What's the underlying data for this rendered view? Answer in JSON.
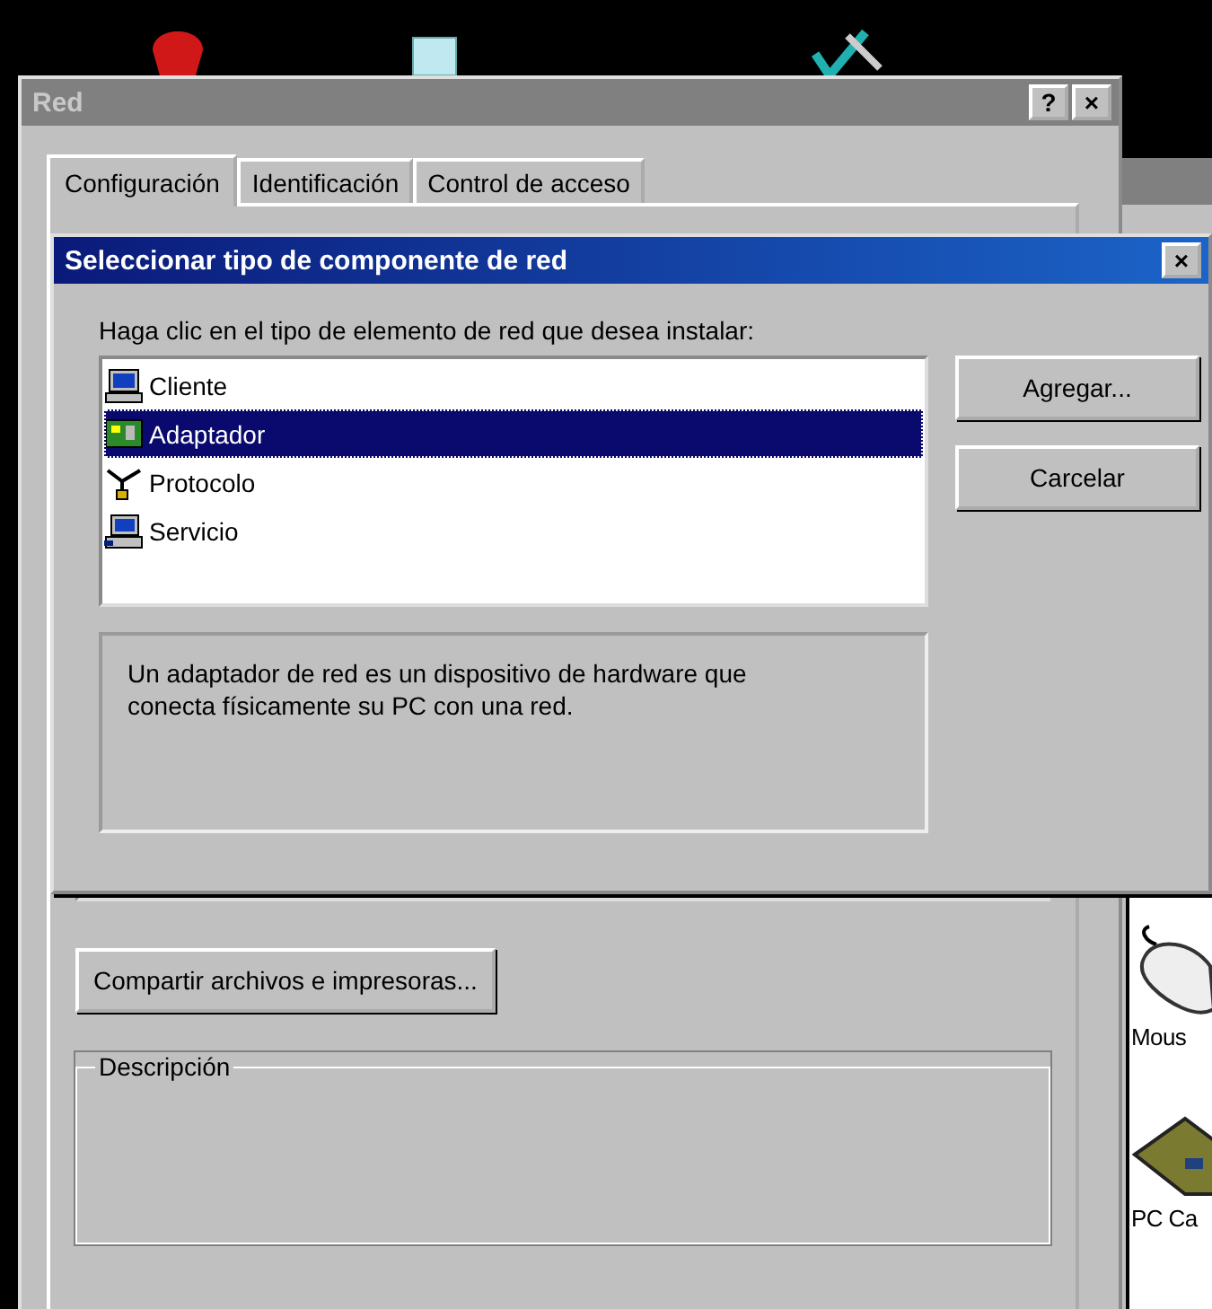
{
  "main_window": {
    "title": "Red",
    "help_button": "?",
    "close_button": "×",
    "tabs": [
      {
        "label": "Configuración",
        "selected": true
      },
      {
        "label": "Identificación",
        "selected": false
      },
      {
        "label": "Control de acceso",
        "selected": false
      }
    ],
    "share_button": "Compartir archivos e impresoras...",
    "description_legend": "Descripción"
  },
  "dialog": {
    "title": "Seleccionar tipo de componente de red",
    "close_button": "×",
    "instruction": "Haga clic en el tipo de elemento de red que desea instalar:",
    "components": [
      {
        "label": "Cliente",
        "kind": "client",
        "selected": false
      },
      {
        "label": "Adaptador",
        "kind": "adapter",
        "selected": true
      },
      {
        "label": "Protocolo",
        "kind": "protocol",
        "selected": false
      },
      {
        "label": "Servicio",
        "kind": "service",
        "selected": false
      }
    ],
    "description": "Un adaptador de red es un dispositivo de hardware que conecta físicamente su PC con una red.",
    "buttons": [
      "Agregar...",
      "Carcelar"
    ]
  },
  "background_window": {
    "items": [
      {
        "label": "Mous",
        "kind": "mouse"
      },
      {
        "label": "PC Ca",
        "kind": "card"
      }
    ]
  }
}
